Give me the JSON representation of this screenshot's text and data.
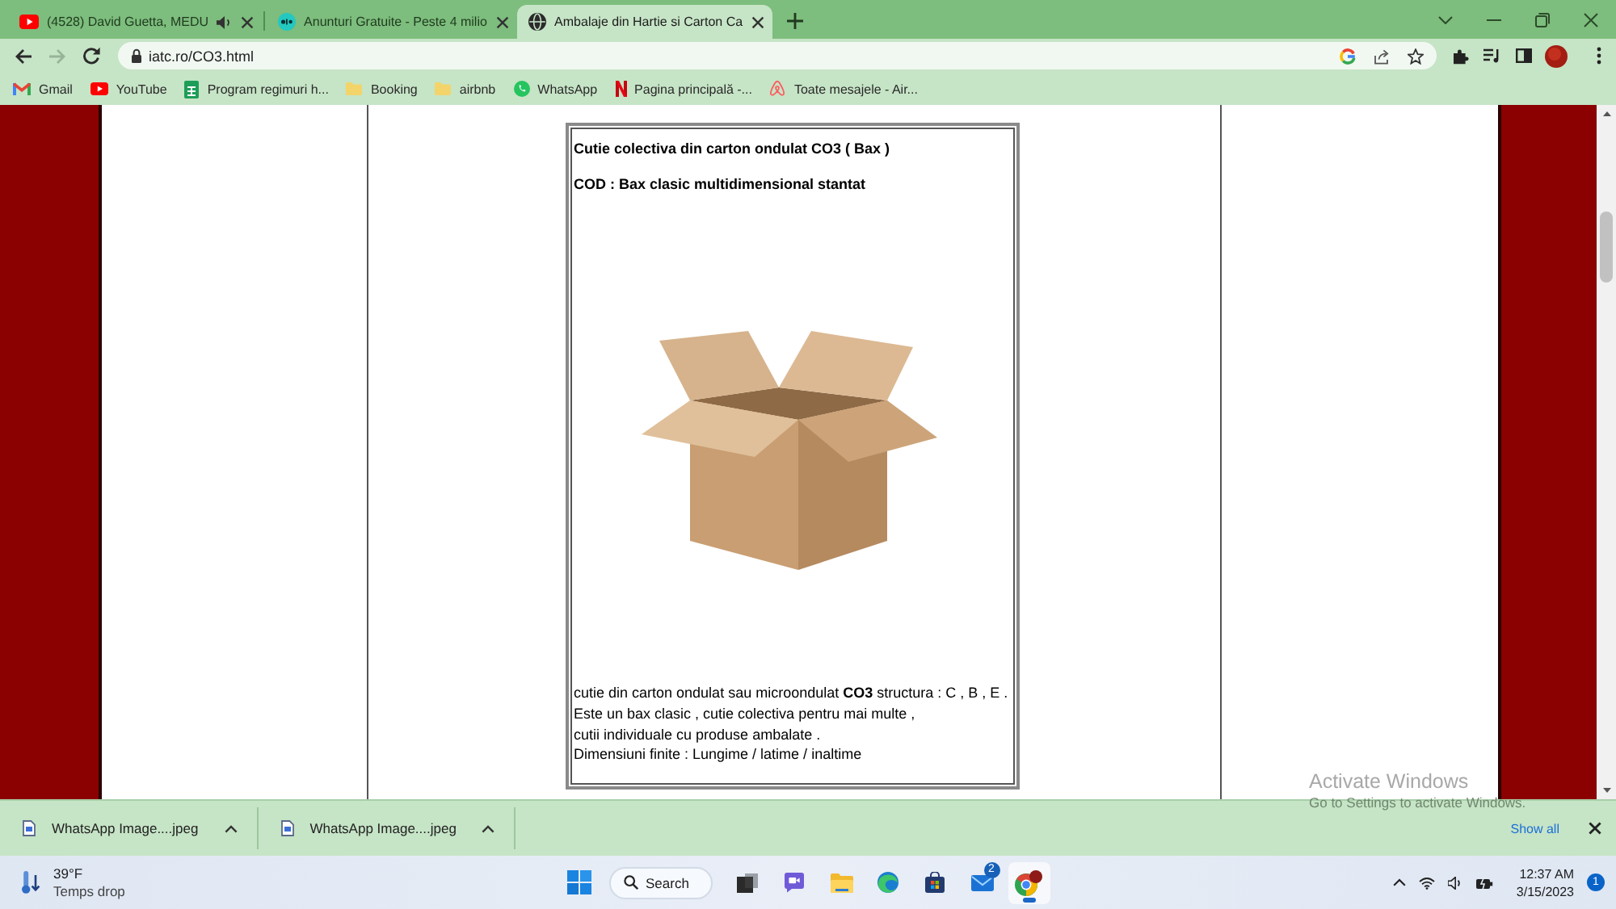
{
  "browser": {
    "tabs": [
      {
        "kind": "youtube",
        "title": "(4528) David Guetta, MEDU",
        "audio": true,
        "selected": false
      },
      {
        "kind": "classifieds",
        "title": "Anunturi Gratuite - Peste 4 milio",
        "audio": false,
        "selected": false
      },
      {
        "kind": "globe",
        "title": "Ambalaje din Hartie si Carton Ca",
        "audio": false,
        "selected": true
      }
    ],
    "nav": [
      {
        "kind": "back",
        "disabled": false
      },
      {
        "kind": "forward",
        "disabled": true
      },
      {
        "kind": "reload",
        "disabled": false
      }
    ],
    "address": "iatc.ro/CO3.html",
    "bookmarks": [
      {
        "kind": "gmail",
        "label": "Gmail"
      },
      {
        "kind": "youtube",
        "label": "YouTube"
      },
      {
        "kind": "sheets",
        "label": "Program regimuri h..."
      },
      {
        "kind": "folder",
        "label": "Booking"
      },
      {
        "kind": "folder",
        "label": "airbnb"
      },
      {
        "kind": "whatsapp",
        "label": "WhatsApp"
      },
      {
        "kind": "netflix",
        "label": "Pagina principală -..."
      },
      {
        "kind": "airbnb",
        "label": "Toate mesajele - Air..."
      }
    ]
  },
  "page": {
    "product": {
      "title": "Cutie colectiva din carton ondulat CO3 ( Bax )",
      "code": "COD : Bax clasic multidimensional stantat",
      "description": [
        "cutie din carton ondulat sau microondulat **CO3** structura : C , B , E .",
        "Este un bax clasic , cutie colectiva pentru mai multe ,",
        "cutii individuale cu produse ambalate .",
        "Dimensiuni finite : Lungime / latime / inaltime"
      ]
    }
  },
  "activation_notice": {
    "title": "Activate Windows",
    "subtitle": "Go to Settings to activate Windows."
  },
  "downloads": {
    "files": [
      {
        "name": "WhatsApp Image....jpeg"
      },
      {
        "name": "WhatsApp Image....jpeg"
      }
    ],
    "show_all": "Show all"
  },
  "taskbar": {
    "weather": {
      "temperature": "39°F",
      "condition": "Temps drop"
    },
    "search": "Search",
    "apps": [
      {
        "kind": "taskview",
        "active": false
      },
      {
        "kind": "chat",
        "active": false
      },
      {
        "kind": "explorer",
        "active": false
      },
      {
        "kind": "edge",
        "active": false
      },
      {
        "kind": "store",
        "active": false
      },
      {
        "kind": "mail",
        "active": false,
        "badge": "2"
      },
      {
        "kind": "chrome",
        "active": true
      }
    ],
    "time": "12:37 AM",
    "date": "3/15/2023",
    "notification_count": "1"
  }
}
